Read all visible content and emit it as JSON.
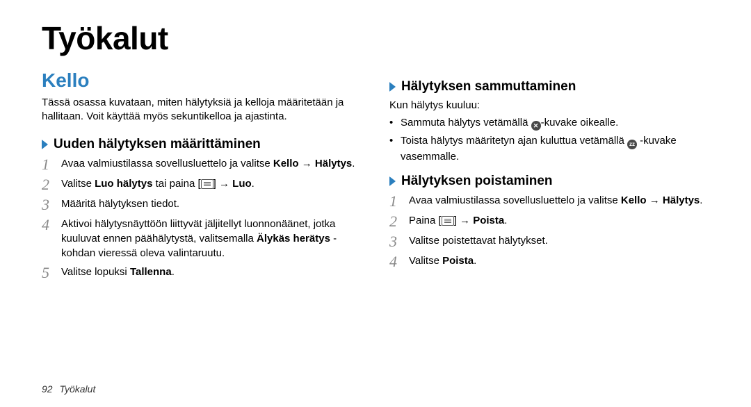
{
  "title": "Työkalut",
  "footer": {
    "page": "92",
    "section": "Työkalut"
  },
  "left": {
    "section": "Kello",
    "intro": "Tässä osassa kuvataan, miten hälytyksiä ja kelloja määritetään ja hallitaan. Voit käyttää myös sekuntikelloa ja ajastinta.",
    "sub1": {
      "title": "Uuden hälytyksen määrittäminen",
      "steps": {
        "s1_pre": "Avaa valmiustilassa sovellusluettelo ja valitse ",
        "s1_b1": "Kello",
        "s1_arrow": " → ",
        "s1_b2": "Hälytys",
        "s1_post": ".",
        "s2_pre": "Valitse ",
        "s2_b1": "Luo hälytys",
        "s2_mid": " tai paina [",
        "s2_mid2": "] → ",
        "s2_b2": "Luo",
        "s2_post": ".",
        "s3": "Määritä hälytyksen tiedot.",
        "s4_pre": "Aktivoi hälytysnäyttöön liittyvät jäljitellyt luonnonäänet, jotka kuuluvat ennen päähälytystä, valitsemalla ",
        "s4_b1": "Älykäs herätys",
        "s4_post": " -kohdan vieressä oleva valintaruutu.",
        "s5_pre": "Valitse lopuksi ",
        "s5_b1": "Tallenna",
        "s5_post": "."
      }
    }
  },
  "right": {
    "sub2": {
      "title": "Hälytyksen sammuttaminen",
      "lead": "Kun hälytys kuuluu:",
      "b1_pre": "Sammuta hälytys vetämällä ",
      "b1_post": "-kuvake oikealle.",
      "b2_pre": "Toista hälytys määritetyn ajan kuluttua vetämällä ",
      "b2_post": " -kuvake vasemmalle."
    },
    "sub3": {
      "title": "Hälytyksen poistaminen",
      "steps": {
        "s1_pre": "Avaa valmiustilassa sovellusluettelo ja valitse ",
        "s1_b1": "Kello",
        "s1_arrow": " → ",
        "s1_b2": "Hälytys",
        "s1_post": ".",
        "s2_pre": "Paina [",
        "s2_mid": "] → ",
        "s2_b1": "Poista",
        "s2_post": ".",
        "s3": "Valitse poistettavat hälytykset.",
        "s4_pre": "Valitse ",
        "s4_b1": "Poista",
        "s4_post": "."
      }
    }
  },
  "nums": {
    "1": "1",
    "2": "2",
    "3": "3",
    "4": "4",
    "5": "5"
  },
  "icons": {
    "stop": "✕",
    "snooze": "zz"
  }
}
